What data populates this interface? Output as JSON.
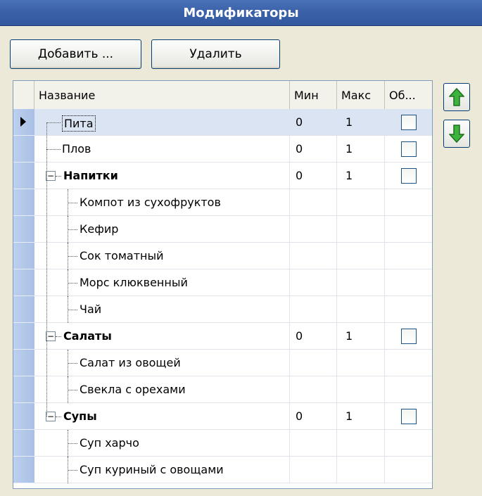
{
  "window": {
    "title": "Модификаторы"
  },
  "toolbar": {
    "add_label": "Добавить ...",
    "delete_label": "Удалить"
  },
  "grid": {
    "columns": [
      "Название",
      "Мин",
      "Макс",
      "Об..."
    ],
    "rows": [
      {
        "name": "Пита",
        "bold": false,
        "level": 0,
        "min": "0",
        "max": "1",
        "checkbox": true,
        "checked": false,
        "selected": true
      },
      {
        "name": "Плов",
        "bold": false,
        "level": 0,
        "min": "0",
        "max": "1",
        "checkbox": true,
        "checked": false
      },
      {
        "name": "Напитки",
        "bold": true,
        "level": 0,
        "group": true,
        "min": "0",
        "max": "1",
        "checkbox": true,
        "checked": false
      },
      {
        "name": "Компот из сухофруктов",
        "bold": false,
        "level": 1,
        "min": "",
        "max": "",
        "checkbox": false
      },
      {
        "name": "Кефир",
        "bold": false,
        "level": 1,
        "min": "",
        "max": "",
        "checkbox": false
      },
      {
        "name": "Сок томатный",
        "bold": false,
        "level": 1,
        "min": "",
        "max": "",
        "checkbox": false
      },
      {
        "name": "Морс клюквенный",
        "bold": false,
        "level": 1,
        "min": "",
        "max": "",
        "checkbox": false
      },
      {
        "name": "Чай",
        "bold": false,
        "level": 1,
        "min": "",
        "max": "",
        "checkbox": false
      },
      {
        "name": "Салаты",
        "bold": true,
        "level": 0,
        "group": true,
        "min": "0",
        "max": "1",
        "checkbox": true,
        "checked": false
      },
      {
        "name": "Салат из овощей",
        "bold": false,
        "level": 1,
        "min": "",
        "max": "",
        "checkbox": false
      },
      {
        "name": "Свекла с орехами",
        "bold": false,
        "level": 1,
        "min": "",
        "max": "",
        "checkbox": false
      },
      {
        "name": "Супы",
        "bold": true,
        "level": 0,
        "group": true,
        "min": "0",
        "max": "1",
        "checkbox": true,
        "checked": false
      },
      {
        "name": "Суп харчо",
        "bold": false,
        "level": 1,
        "min": "",
        "max": "",
        "checkbox": false
      },
      {
        "name": "Суп куриный с овощами",
        "bold": false,
        "level": 1,
        "min": "",
        "max": "",
        "checkbox": false
      }
    ]
  },
  "side_buttons": {
    "up_icon": "green-up-arrow-icon",
    "down_icon": "green-down-arrow-icon"
  },
  "colors": {
    "title_bar": "#3a61a8",
    "row_header": "#b4c8ea",
    "arrow_green": "#2e9a2e"
  }
}
